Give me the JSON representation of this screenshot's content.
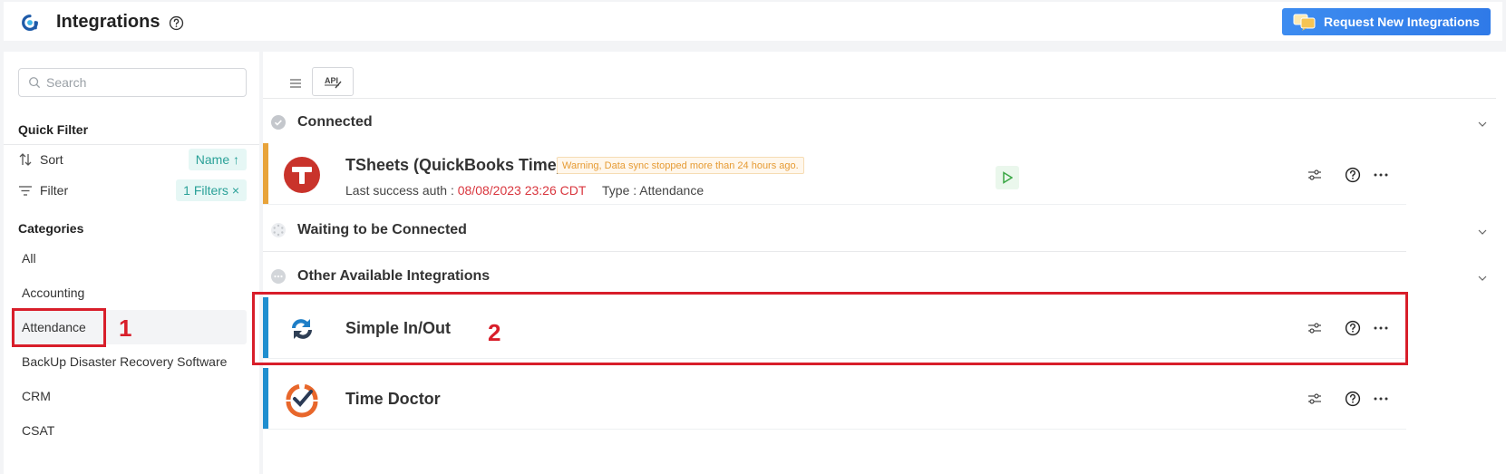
{
  "header": {
    "title": "Integrations",
    "request_button_label": "Request New Integrations"
  },
  "sidebar": {
    "search_placeholder": "Search",
    "quick_filter_title": "Quick Filter",
    "sort_label": "Sort",
    "sort_value": "Name ↑",
    "filter_label": "Filter",
    "filter_value": "1 Filters ×",
    "categories_title": "Categories",
    "categories": [
      "All",
      "Accounting",
      "Attendance",
      "BackUp Disaster Recovery Software",
      "CRM",
      "CSAT"
    ],
    "active_category": "Attendance"
  },
  "toolbar": {
    "api_label": "API"
  },
  "sections": {
    "connected": "Connected",
    "waiting": "Waiting to be Connected",
    "other": "Other Available Integrations"
  },
  "integrations": {
    "tsheets": {
      "name": "TSheets (QuickBooks Time)",
      "warning": "Warning, Data sync stopped more than 24 hours ago.",
      "last_auth_label": "Last success auth :",
      "last_auth_value": "08/08/2023 23:26 CDT",
      "type_label": "Type : Attendance"
    },
    "simple_inout": {
      "name": "Simple In/Out"
    },
    "time_doctor": {
      "name": "Time Doctor"
    }
  },
  "annotations": {
    "label_1": "1",
    "label_2": "2"
  },
  "colors": {
    "accent_blue": "#2f7ae8",
    "connected_bar": "#e8a33a",
    "available_bar": "#1f8ecf",
    "annotation_red": "#d81e2a",
    "chip_teal": "#2aa198"
  },
  "icons": [
    "logo-icon",
    "help-icon",
    "chat-icon",
    "search-icon",
    "sort-icon",
    "filter-icon",
    "list-view-icon",
    "api-icon",
    "check-circle-icon",
    "loading-circle-icon",
    "chat-bubble-icon",
    "chevron-down-icon",
    "play-icon",
    "settings-sliders-icon",
    "more-icon"
  ]
}
